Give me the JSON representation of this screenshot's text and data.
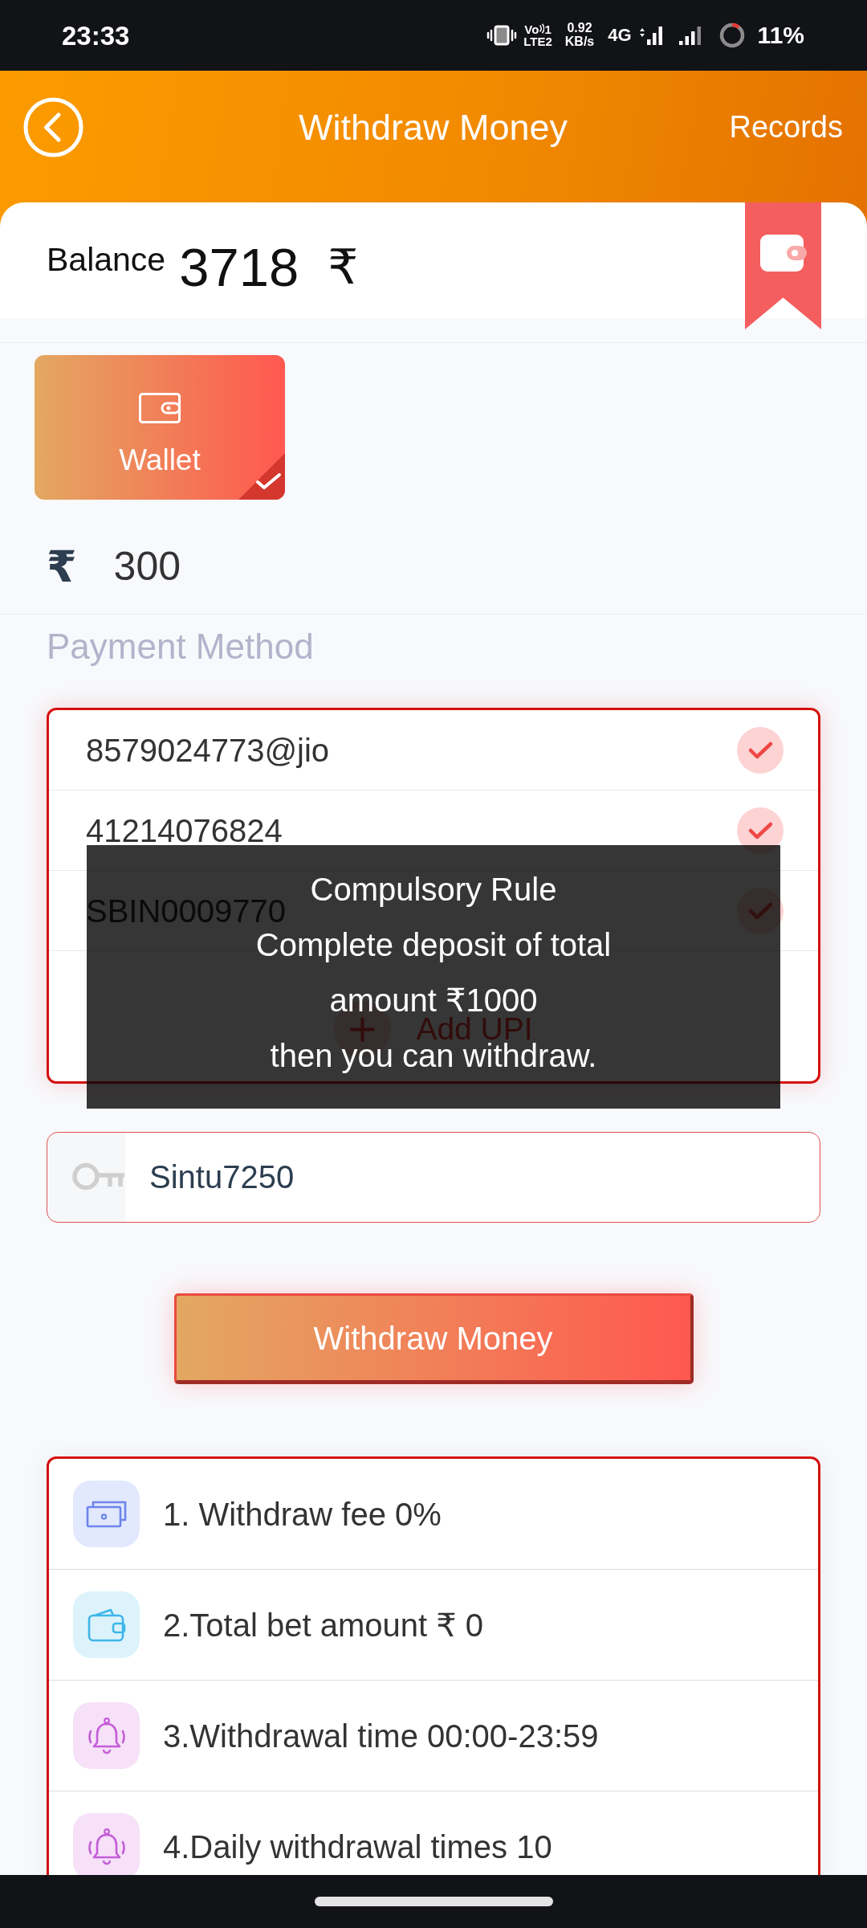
{
  "status_bar": {
    "time": "23:33",
    "volte_top": "Vo",
    "volte_sim": "1",
    "volte_bottom": "LTE2",
    "speed": "0.92",
    "speed_unit": "KB/s",
    "network": "4G",
    "battery": "11%"
  },
  "header": {
    "title": "Withdraw Money",
    "action": "Records"
  },
  "balance": {
    "label": "Balance",
    "amount": "3718",
    "currency": "₹"
  },
  "wallets": [
    {
      "label": "Wallet",
      "selected": true
    }
  ],
  "amount": {
    "currency": "₹",
    "value": "300"
  },
  "payment_method": {
    "label": "Payment Method",
    "accounts": [
      {
        "text": "8579024773@jio",
        "checked": true
      },
      {
        "text": "41214076824",
        "checked": true
      },
      {
        "text": "SBIN0009770",
        "checked": true
      }
    ],
    "add_button": "Add UPI"
  },
  "password": {
    "value": "Sintu7250"
  },
  "submit": "Withdraw Money",
  "rules": [
    {
      "kind": "cash",
      "text": "1. Withdraw fee 0%"
    },
    {
      "kind": "wallet",
      "text": "2.Total bet amount ₹ 0"
    },
    {
      "kind": "bell",
      "text": "3.Withdrawal time 00:00-23:59"
    },
    {
      "kind": "bell",
      "text": "4.Daily withdrawal times 10"
    }
  ],
  "toast": {
    "title": "Compulsory Rule",
    "lines": [
      "Complete deposit of total",
      "amount ₹1000",
      "then you can withdraw."
    ]
  }
}
